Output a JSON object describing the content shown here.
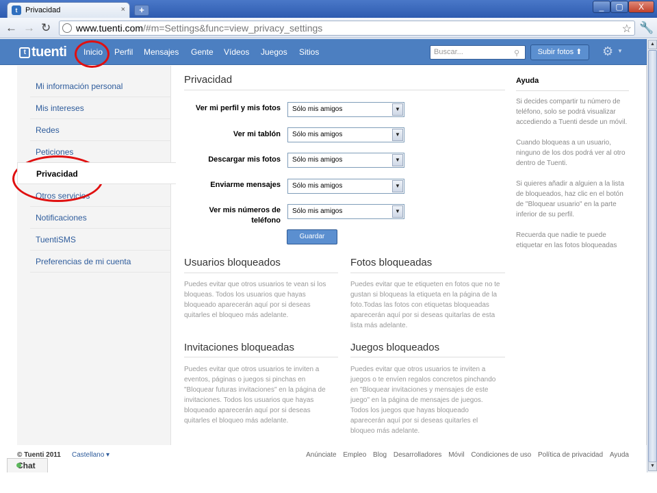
{
  "browser": {
    "tab_title": "Privacidad",
    "tab_close": "×",
    "new_tab": "+",
    "url_host": "www.tuenti.com",
    "url_rest": "/#m=Settings&func=view_privacy_settings",
    "window_buttons": [
      "_",
      "▢",
      "X"
    ]
  },
  "header": {
    "logo": "tuenti",
    "nav": [
      "Inicio",
      "Perfil",
      "Mensajes",
      "Gente",
      "Vídeos",
      "Juegos",
      "Sitios"
    ],
    "search_placeholder": "Buscar...",
    "upload_label": "Subir fotos"
  },
  "sidebar": {
    "items": [
      "Mi información personal",
      "Mis intereses",
      "Redes",
      "Peticiones",
      "Privacidad",
      "Otros servicios",
      "Notificaciones",
      "TuentiSMS",
      "Preferencias de mi cuenta"
    ]
  },
  "main": {
    "title": "Privacidad",
    "settings": [
      {
        "label": "Ver mi perfil y mis fotos",
        "value": "Sólo mis amigos"
      },
      {
        "label": "Ver mi tablón",
        "value": "Sólo mis amigos"
      },
      {
        "label": "Descargar mis fotos",
        "value": "Sólo mis amigos"
      },
      {
        "label": "Enviarme mensajes",
        "value": "Sólo mis amigos"
      },
      {
        "label": "Ver mis números de teléfono",
        "value": "Sólo mis amigos"
      }
    ],
    "save_label": "Guardar",
    "sections": [
      {
        "title": "Usuarios bloqueados",
        "lines": [
          "Puedes evitar que otros usuarios te vean si los",
          "bloqueas. Todos los usuarios que hayas",
          "bloqueado aparecerán aquí por si deseas",
          "quitarles el bloqueo más adelante."
        ]
      },
      {
        "title": "Fotos bloqueadas",
        "lines": [
          "Puedes evitar que te etiqueten en fotos que no te",
          "gustan si bloqueas la etiqueta en la página de la",
          "foto.Todas las fotos con etiquetas bloqueadas",
          "aparecerán aquí por si deseas quitarlas de esta",
          "lista más adelante."
        ]
      },
      {
        "title": "Invitaciones bloqueadas",
        "lines": [
          "Puedes evitar que otros usuarios te inviten a",
          "eventos, páginas o juegos si pinchas en",
          "\"Bloquear futuras invitaciones\" en la página de",
          "invitaciones. Todos los usuarios que hayas",
          "bloqueado aparecerán aquí por si deseas",
          "quitarles el bloqueo más adelante."
        ]
      },
      {
        "title": "Juegos bloqueados",
        "lines": [
          "Puedes evitar que otros usuarios te inviten a",
          "juegos o te envíen regalos concretos pinchando",
          "en \"Bloquear invitaciones y mensajes de este",
          "juego\" en la página de mensajes de juegos.",
          "Todos los juegos que hayas bloqueado",
          "aparecerán aquí por si deseas quitarles el",
          "bloqueo más adelante."
        ]
      }
    ]
  },
  "help": {
    "title": "Ayuda",
    "paragraphs": [
      [
        "Si decides compartir tu número de",
        "teléfono, solo se podrá visualizar",
        "accediendo a Tuenti desde un móvil."
      ],
      [
        "Cuando bloqueas a un usuario,",
        "ninguno de los dos podrá ver al otro",
        "dentro de Tuenti."
      ],
      [
        "Si quieres añadir a alguien a la lista",
        "de bloqueados, haz clic en el botón",
        "de \"Bloquear usuario\" en la parte",
        "inferior de su perfil."
      ],
      [
        "Recuerda que nadie te puede",
        "etiquetar en las fotos bloqueadas"
      ]
    ]
  },
  "footer": {
    "copyright": "© Tuenti 2011",
    "language": "Castellano ▾",
    "links": [
      "Anúnciate",
      "Empleo",
      "Blog",
      "Desarrolladores",
      "Móvil",
      "Condiciones de uso",
      "Política de privacidad",
      "Ayuda"
    ]
  },
  "chat": {
    "label": "Chat"
  },
  "colors": {
    "brand": "#4c7fc1",
    "link": "#2d5b9b",
    "annotation": "#e01010"
  }
}
